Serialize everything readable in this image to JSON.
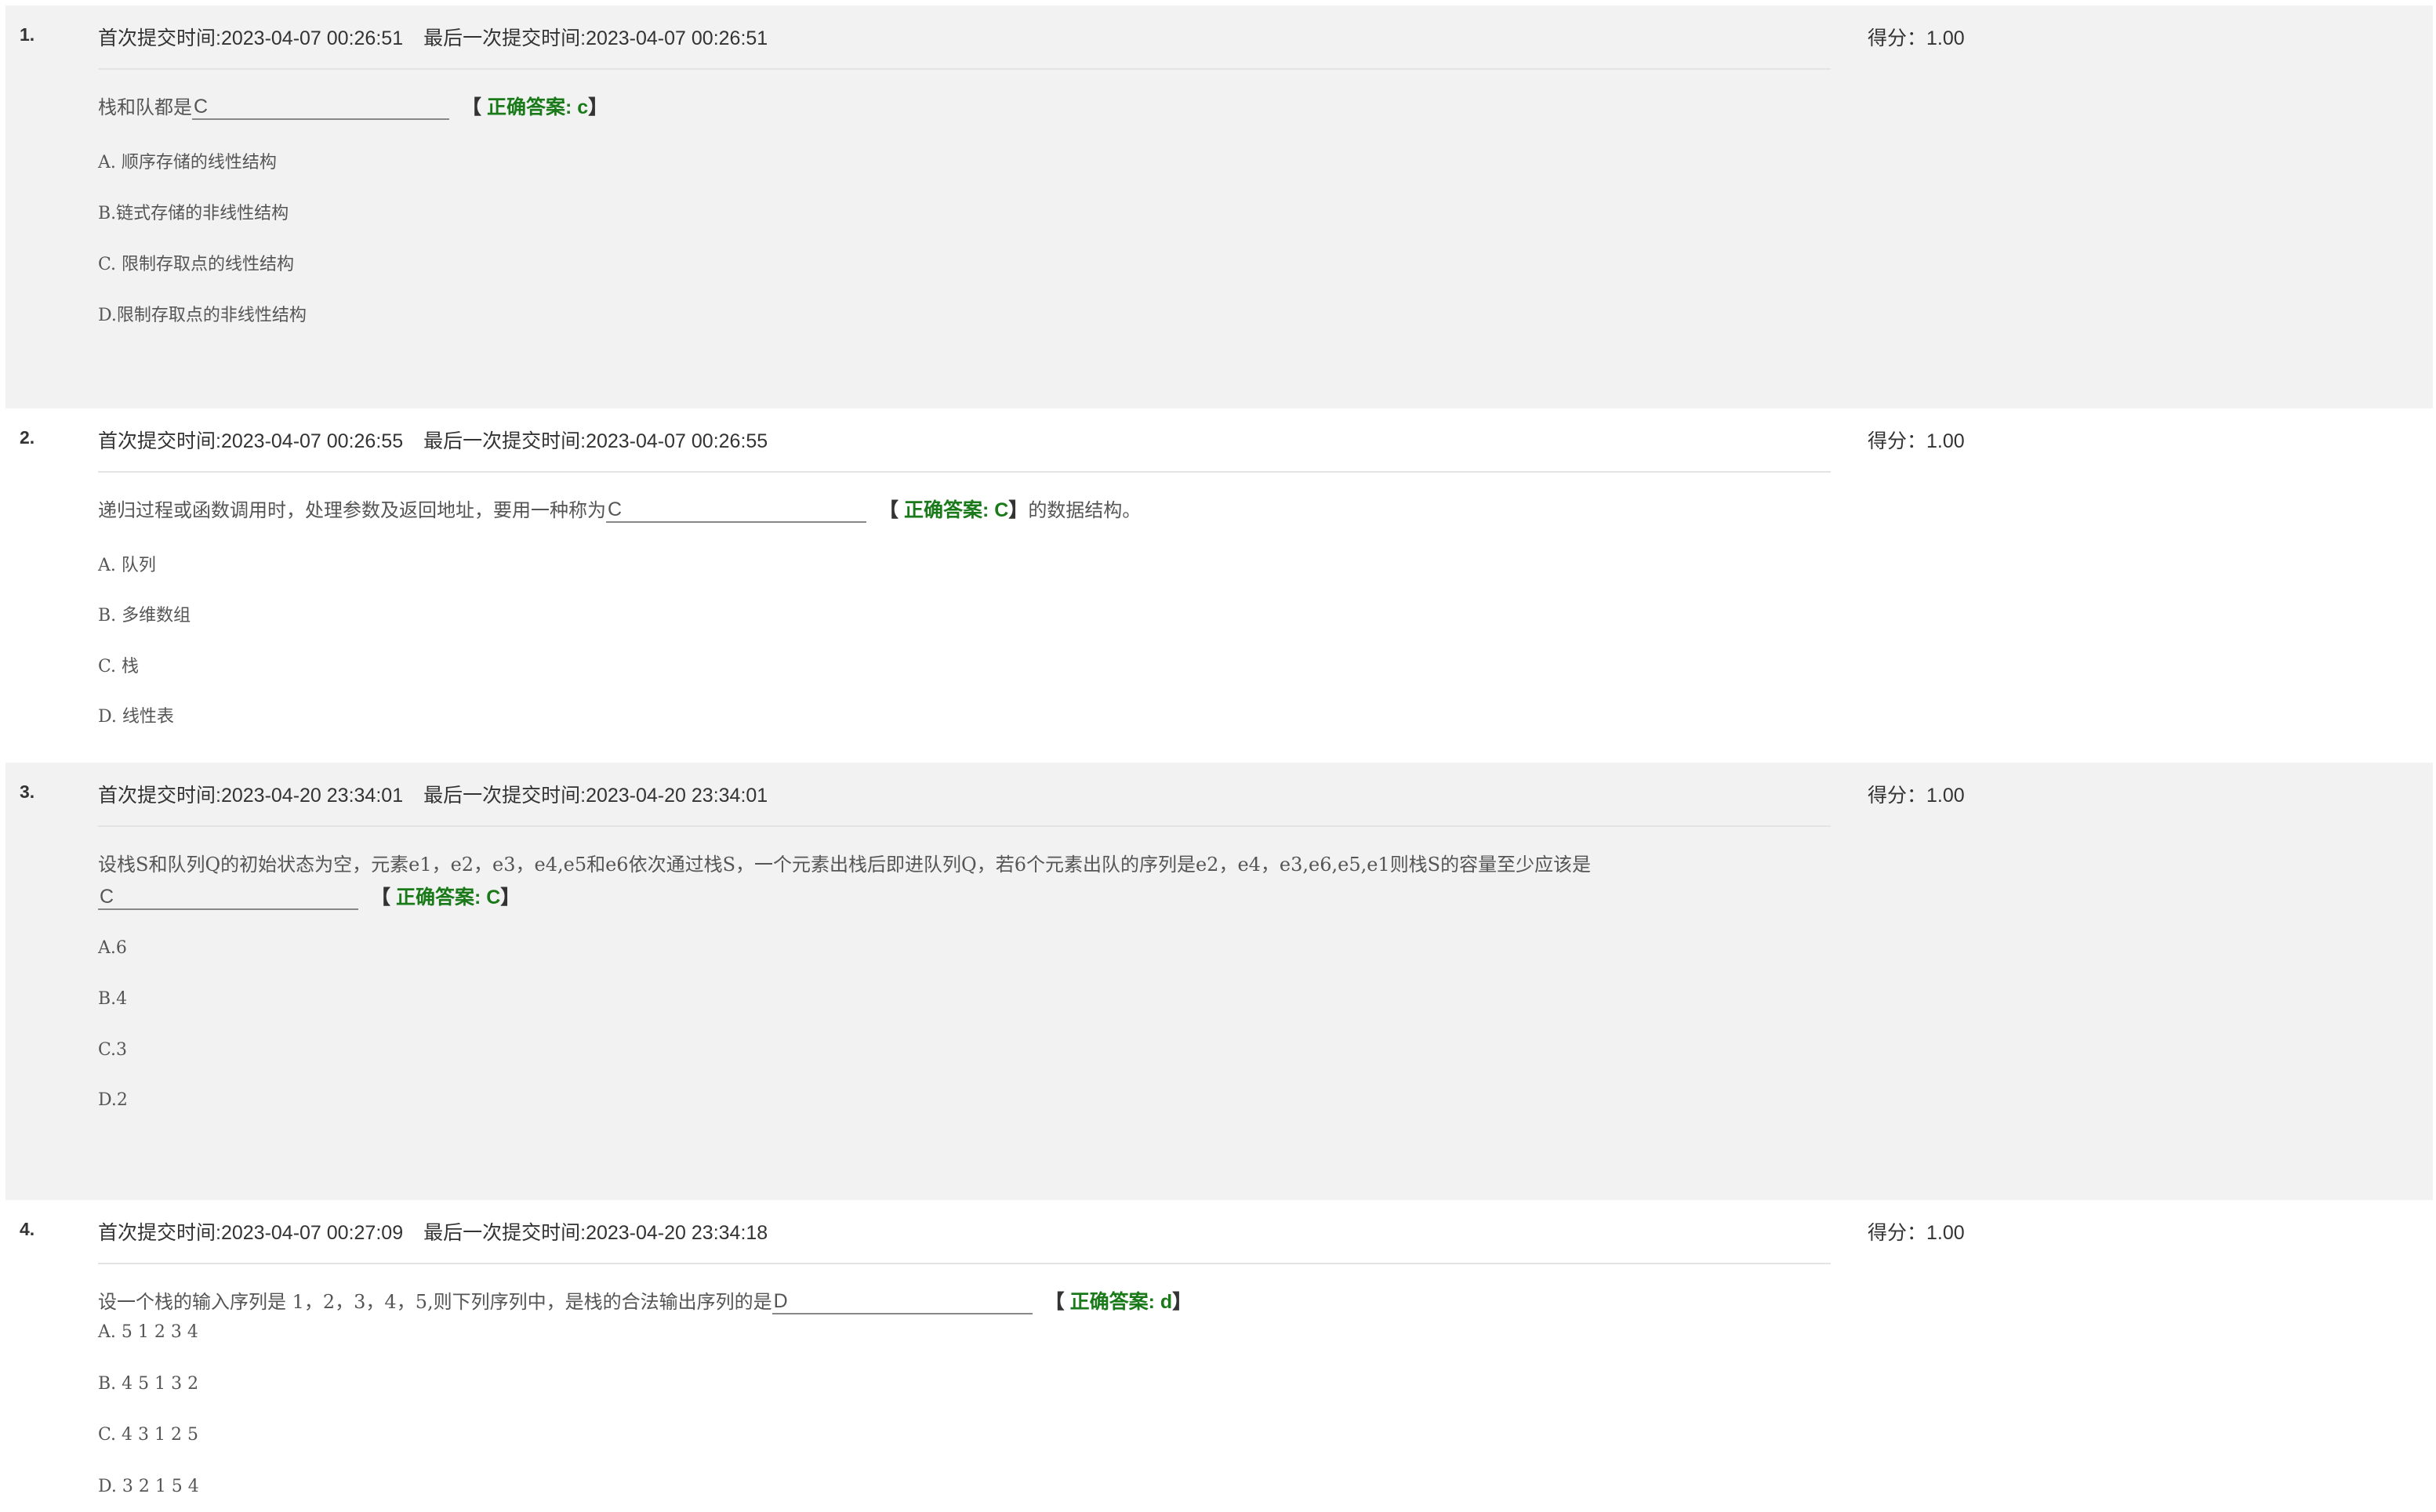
{
  "header_labels": {
    "first_submit": "首次提交时间:",
    "last_submit": "最后一次提交时间:",
    "score": "得分：",
    "answer_prefix": "正确答案: ",
    "bracket_open": "【 ",
    "bracket_close": "】"
  },
  "questions": [
    {
      "number": "1.",
      "first_time": "2023-04-07 00:26:51",
      "last_time": "2023-04-07 00:26:51",
      "score": "1.00",
      "stem_before": "栈和队都是",
      "blank_value": "C",
      "answer": "c",
      "stem_after": "",
      "options": [
        "A. 顺序存储的线性结构",
        "B.链式存储的非线性结构",
        "C. 限制存取点的线性结构",
        "D.限制存取点的非线性结构"
      ]
    },
    {
      "number": "2.",
      "first_time": "2023-04-07 00:26:55",
      "last_time": "2023-04-07 00:26:55",
      "score": "1.00",
      "stem_before": "递归过程或函数调用时，处理参数及返回地址，要用一种称为",
      "blank_value": "C",
      "answer": "C",
      "stem_after": "的数据结构。",
      "options": [
        "A. 队列",
        "B. 多维数组",
        "C. 栈",
        "D. 线性表"
      ]
    },
    {
      "number": "3.",
      "first_time": "2023-04-20 23:34:01",
      "last_time": "2023-04-20 23:34:01",
      "score": "1.00",
      "stem_before": "设栈S和队列Q的初始状态为空，元素e1，e2，e3，e4,e5和e6依次通过栈S，一个元素出栈后即进队列Q，若6个元素出队的序列是e2，e4，e3,e6,e5,e1则栈S的容量至少应该是",
      "blank_value": "C",
      "answer": "C",
      "stem_after": "",
      "options": [
        "A.6",
        "B.4",
        "C.3",
        "D.2"
      ]
    },
    {
      "number": "4.",
      "first_time": "2023-04-07 00:27:09",
      "last_time": "2023-04-20 23:34:18",
      "score": "1.00",
      "stem_before": "设一个栈的输入序列是 1，2，3，4，5,则下列序列中，是栈的合法输出序列的是",
      "blank_value": "D",
      "answer": "d",
      "stem_after": "",
      "options": [
        "A. 5 1 2 3 4",
        "B. 4 5 1 3 2",
        "C. 4 3 1 2 5",
        "D. 3 2 1 5 4"
      ]
    }
  ]
}
